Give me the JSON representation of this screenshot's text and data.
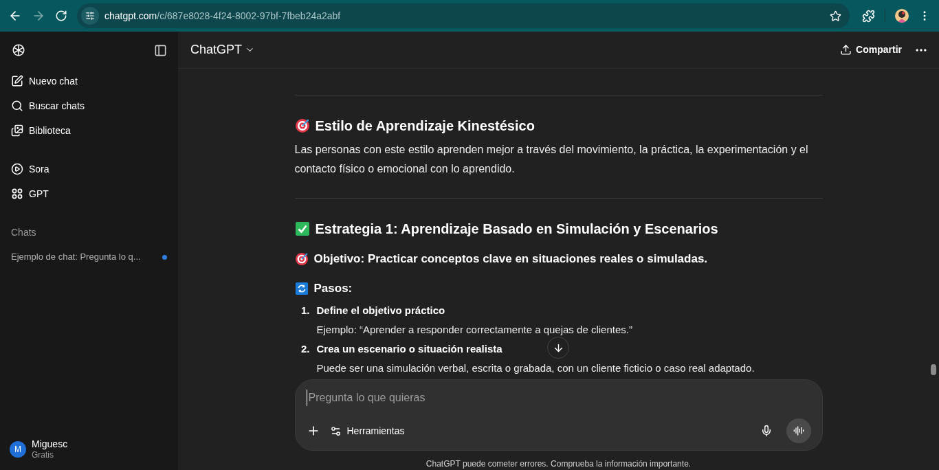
{
  "browser": {
    "url_host": "chatgpt.com",
    "url_path": "/c/687e8028-4f24-8002-97bf-7fbeb24a2abf"
  },
  "sidebar": {
    "nav": [
      {
        "kind": "compose",
        "label": "Nuevo chat"
      },
      {
        "kind": "search",
        "label": "Buscar chats"
      },
      {
        "kind": "library",
        "label": "Biblioteca"
      }
    ],
    "tools": [
      {
        "kind": "play",
        "label": "Sora"
      },
      {
        "kind": "apps",
        "label": "GPT"
      }
    ],
    "section": "Chats",
    "chats": [
      {
        "title": "Ejemplo de chat: Pregunta lo q...",
        "unread": true
      }
    ],
    "user": {
      "initial": "M",
      "name": "Miguesc",
      "plan": "Gratis"
    }
  },
  "header": {
    "model": "ChatGPT",
    "share": "Compartir"
  },
  "content": [
    {
      "kind": "divider"
    },
    {
      "kind": "title",
      "text": "Estilo de Aprendizaje Kinestésico"
    },
    {
      "kind": "paragraph",
      "text": "Las personas con este estilo aprenden mejor a través del movimiento, la práctica, la experimentación y el contacto físico o emocional con lo aprendido."
    },
    {
      "kind": "divider"
    },
    {
      "kind": "strategy",
      "text": "Estrategia 1: Aprendizaje Basado en Simulación y Escenarios"
    },
    {
      "kind": "objective",
      "text": "Objetivo: Practicar conceptos clave en situaciones reales o simuladas."
    },
    {
      "kind": "steps",
      "text": "Pasos:"
    },
    {
      "kind": "step",
      "number": "1.",
      "title": "Define el objetivo práctico",
      "detail": "Ejemplo: “Aprender a responder correctamente a quejas de clientes.”"
    },
    {
      "kind": "step",
      "number": "2.",
      "title": "Crea un escenario o situación realista",
      "detail": "Puede ser una simulación verbal, escrita o grabada, con un cliente ficticio o caso real adaptado."
    }
  ],
  "composer": {
    "placeholder": "Pregunta lo que quieras",
    "tools": "Herramientas"
  },
  "disclaimer": "ChatGPT puede cometer errores. Comprueba la información importante."
}
